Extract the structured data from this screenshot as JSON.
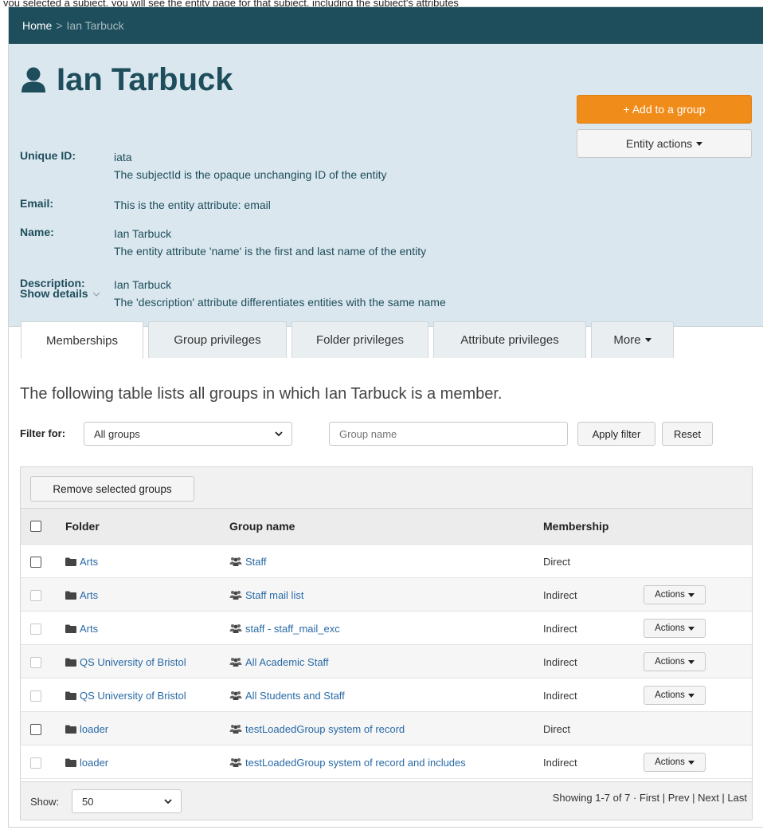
{
  "top_snippet": "you selected a subject, you will see the entity page for that subject, including the subject's attributes",
  "breadcrumb": {
    "home": "Home",
    "separator": ">",
    "current": "Ian Tarbuck"
  },
  "entity": {
    "name": "Ian Tarbuck",
    "add_group_label": "+ Add to a group",
    "entity_actions_label": "Entity actions",
    "attributes": [
      {
        "label": "Unique ID:",
        "line1": "iata",
        "line2": "The subjectId is the opaque unchanging ID of the entity"
      },
      {
        "label": "Email:",
        "line1": "This is the entity attribute: email",
        "line2": ""
      },
      {
        "label": "Name:",
        "line1": "Ian Tarbuck",
        "line2": "The entity attribute 'name' is the first and last name of the entity"
      },
      {
        "label": "Description:",
        "line1": "Ian Tarbuck",
        "line2": "The 'description' attribute differentiates entities with the same name"
      }
    ],
    "show_details": "Show details"
  },
  "tabs": [
    {
      "label": "Memberships",
      "active": true
    },
    {
      "label": "Group privileges"
    },
    {
      "label": "Folder privileges"
    },
    {
      "label": "Attribute privileges"
    },
    {
      "label": "More"
    }
  ],
  "intro_text": "The following table lists all groups in which Ian Tarbuck is a member.",
  "filter": {
    "label": "Filter for:",
    "selected": "All groups",
    "group_name_placeholder": "Group name",
    "apply_label": "Apply filter",
    "reset_label": "Reset"
  },
  "table": {
    "remove_label": "Remove selected groups",
    "columns": {
      "folder": "Folder",
      "group": "Group name",
      "membership": "Membership"
    },
    "actions_label": "Actions",
    "rows": [
      {
        "folder": "Arts",
        "group": "Staff",
        "membership": "Direct",
        "checkbox_enabled": true,
        "has_actions": false
      },
      {
        "folder": "Arts",
        "group": "Staff mail list",
        "membership": "Indirect",
        "checkbox_enabled": false,
        "has_actions": true
      },
      {
        "folder": "Arts",
        "group": "staff - staff_mail_exc",
        "membership": "Indirect",
        "checkbox_enabled": false,
        "has_actions": true
      },
      {
        "folder": "QS University of Bristol",
        "group": "All Academic Staff",
        "membership": "Indirect",
        "checkbox_enabled": false,
        "has_actions": true
      },
      {
        "folder": "QS University of Bristol",
        "group": "All Students and Staff",
        "membership": "Indirect",
        "checkbox_enabled": false,
        "has_actions": true
      },
      {
        "folder": "loader",
        "group": "testLoadedGroup system of record",
        "membership": "Direct",
        "checkbox_enabled": true,
        "has_actions": false
      },
      {
        "folder": "loader",
        "group": "testLoadedGroup system of record and includes",
        "membership": "Indirect",
        "checkbox_enabled": false,
        "has_actions": true
      }
    ],
    "show_label": "Show:",
    "page_size": "50",
    "pager": "Showing 1-7 of 7 · First | Prev | Next | Last"
  },
  "colors": {
    "brand_dark": "#1e4e5c",
    "header_bg": "#dbe7ee",
    "accent_orange": "#f08c1a",
    "link": "#2a6aa6"
  }
}
